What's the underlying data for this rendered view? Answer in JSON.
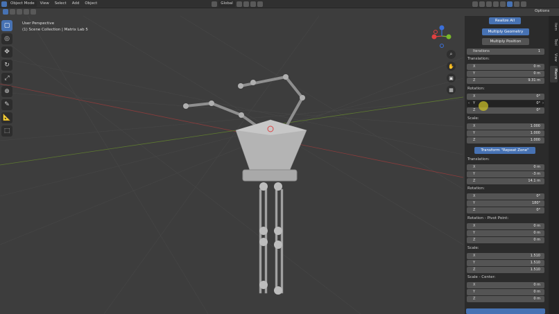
{
  "header": {
    "mode": "Object Mode",
    "menus": [
      "View",
      "Select",
      "Add",
      "Object"
    ],
    "orientation": "Global",
    "options": "Options"
  },
  "viewport": {
    "perspective": "User Perspective",
    "collection": "(1) Scene Collection | Matrix Lab 5"
  },
  "toolbar": {
    "tools": [
      "select-box",
      "cursor",
      "move",
      "rotate",
      "scale",
      "transform",
      "annotate",
      "measure",
      "add-cube"
    ]
  },
  "sidebar_tabs": [
    "Item",
    "Tool",
    "View",
    "Macro"
  ],
  "panel": {
    "realize_all": "Realize All",
    "multiply_geometry": "Multiply Geometry",
    "multiply_position": "Multiply Position",
    "iterations_label": "Iterations",
    "iterations_value": "1",
    "section1": {
      "translation_label": "Translation:",
      "translation": [
        {
          "axis": "X",
          "value": "0 m"
        },
        {
          "axis": "Y",
          "value": "0 m"
        },
        {
          "axis": "Z",
          "value": "9.31 m"
        }
      ],
      "rotation_label": "Rotation:",
      "rotation": [
        {
          "axis": "X",
          "value": "0°"
        },
        {
          "axis": "Y",
          "value": "0°"
        },
        {
          "axis": "Z",
          "value": "0°"
        }
      ],
      "scale_label": "Scale:",
      "scale": [
        {
          "axis": "X",
          "value": "1.000"
        },
        {
          "axis": "Y",
          "value": "1.000"
        },
        {
          "axis": "Z",
          "value": "1.000"
        }
      ]
    },
    "transform_button": "Transform \"Repeat Zone\"",
    "section2": {
      "translation_label": "Translation:",
      "translation": [
        {
          "axis": "X",
          "value": "0 m"
        },
        {
          "axis": "Y",
          "value": "-3 m"
        },
        {
          "axis": "Z",
          "value": "14.1 m"
        }
      ],
      "rotation_label": "Rotation:",
      "rotation": [
        {
          "axis": "X",
          "value": "0°"
        },
        {
          "axis": "Y",
          "value": "180°"
        },
        {
          "axis": "Z",
          "value": "0°"
        }
      ],
      "pivot_label": "Rotation - Pivot Point:",
      "pivot": [
        {
          "axis": "X",
          "value": "0 m"
        },
        {
          "axis": "Y",
          "value": "0 m"
        },
        {
          "axis": "Z",
          "value": "0 m"
        }
      ],
      "scale_label": "Scale:",
      "scale": [
        {
          "axis": "X",
          "value": "1.510"
        },
        {
          "axis": "Y",
          "value": "1.510"
        },
        {
          "axis": "Z",
          "value": "1.510"
        }
      ],
      "scale_center_label": "Scale - Center:",
      "scale_center": [
        {
          "axis": "X",
          "value": "0 m"
        },
        {
          "axis": "Y",
          "value": "0 m"
        },
        {
          "axis": "Z",
          "value": "0 m"
        }
      ]
    }
  },
  "colors": {
    "accent": "#4772b3",
    "viewport_bg": "#3d3d3d",
    "panel_bg": "#2b2b2b",
    "gizmo_x": "#e04040",
    "gizmo_y": "#7ab82a",
    "gizmo_z": "#3b6fd8"
  }
}
